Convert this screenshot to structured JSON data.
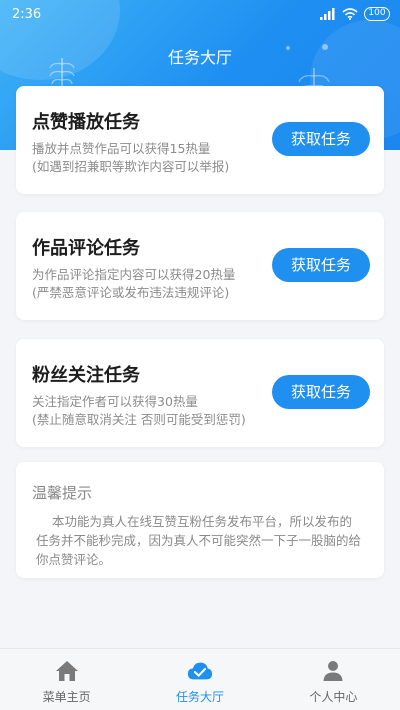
{
  "status_bar": {
    "time": "2:36",
    "battery": "100"
  },
  "header": {
    "title": "任务大厅"
  },
  "tasks": [
    {
      "title": "点赞播放任务",
      "desc1": "播放并点赞作品可以获得15热量",
      "desc2": "(如遇到招兼职等欺诈内容可以举报)",
      "button": "获取任务"
    },
    {
      "title": "作品评论任务",
      "desc1": "为作品评论指定内容可以获得20热量",
      "desc2": "(严禁恶意评论或发布违法违规评论)",
      "button": "获取任务"
    },
    {
      "title": "粉丝关注任务",
      "desc1": "关注指定作者可以获得30热量",
      "desc2": "(禁止随意取消关注 否则可能受到惩罚)",
      "button": "获取任务"
    }
  ],
  "tip": {
    "title": "温馨提示",
    "body": "本功能为真人在线互赞互粉任务发布平台，所以发布的任务并不能秒完成，因为真人不可能突然一下子一股脑的给你点赞评论。"
  },
  "tabbar": {
    "items": [
      {
        "label": "菜单主页",
        "icon": "home-icon"
      },
      {
        "label": "任务大厅",
        "icon": "cloud-check-icon",
        "active": true
      },
      {
        "label": "个人中心",
        "icon": "user-icon"
      }
    ]
  },
  "colors": {
    "primary": "#1f8ff0",
    "header_gradient_start": "#3fb3f6",
    "background": "#f3f5f9"
  }
}
